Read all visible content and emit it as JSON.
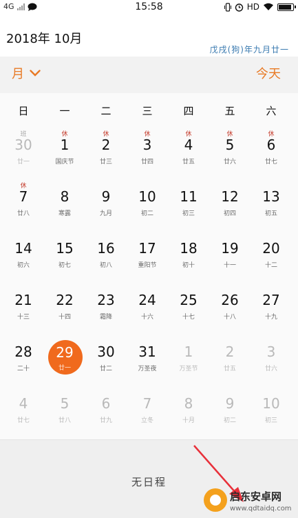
{
  "status_bar": {
    "network": "4G",
    "time": "15:58",
    "hd_label": "HD",
    "battery_level": 0.95,
    "icons": [
      "message-icon",
      "vibrate-icon",
      "alarm-icon",
      "wifi-icon",
      "battery-icon"
    ]
  },
  "header": {
    "year_month": "2018年 10月",
    "lunar_date": "戊戌(狗)年九月廿一"
  },
  "toolbar": {
    "view_label": "月",
    "today_label": "今天"
  },
  "colors": {
    "accent": "#e87a25",
    "selected": "#f06a1d",
    "holiday_tag": "#c43a2a",
    "lunar_text": "#3a7ab0"
  },
  "calendar": {
    "weekdays": [
      "日",
      "一",
      "二",
      "三",
      "四",
      "五",
      "六"
    ],
    "weeks": [
      [
        {
          "day": "30",
          "lunar": "廿一",
          "tag": "班",
          "other": true
        },
        {
          "day": "1",
          "lunar": "国庆节",
          "tag": "休"
        },
        {
          "day": "2",
          "lunar": "廿三",
          "tag": "休"
        },
        {
          "day": "3",
          "lunar": "廿四",
          "tag": "休"
        },
        {
          "day": "4",
          "lunar": "廿五",
          "tag": "休"
        },
        {
          "day": "5",
          "lunar": "廿六",
          "tag": "休"
        },
        {
          "day": "6",
          "lunar": "廿七",
          "tag": "休"
        }
      ],
      [
        {
          "day": "7",
          "lunar": "廿八",
          "tag": "休"
        },
        {
          "day": "8",
          "lunar": "寒露"
        },
        {
          "day": "9",
          "lunar": "九月"
        },
        {
          "day": "10",
          "lunar": "初二"
        },
        {
          "day": "11",
          "lunar": "初三"
        },
        {
          "day": "12",
          "lunar": "初四"
        },
        {
          "day": "13",
          "lunar": "初五"
        }
      ],
      [
        {
          "day": "14",
          "lunar": "初六"
        },
        {
          "day": "15",
          "lunar": "初七"
        },
        {
          "day": "16",
          "lunar": "初八"
        },
        {
          "day": "17",
          "lunar": "重阳节"
        },
        {
          "day": "18",
          "lunar": "初十"
        },
        {
          "day": "19",
          "lunar": "十一"
        },
        {
          "day": "20",
          "lunar": "十二"
        }
      ],
      [
        {
          "day": "21",
          "lunar": "十三"
        },
        {
          "day": "22",
          "lunar": "十四"
        },
        {
          "day": "23",
          "lunar": "霜降"
        },
        {
          "day": "24",
          "lunar": "十六"
        },
        {
          "day": "25",
          "lunar": "十七"
        },
        {
          "day": "26",
          "lunar": "十八"
        },
        {
          "day": "27",
          "lunar": "十九"
        }
      ],
      [
        {
          "day": "28",
          "lunar": "二十"
        },
        {
          "day": "29",
          "lunar": "廿一",
          "selected": true
        },
        {
          "day": "30",
          "lunar": "廿二"
        },
        {
          "day": "31",
          "lunar": "万圣夜"
        },
        {
          "day": "1",
          "lunar": "万圣节",
          "other": true
        },
        {
          "day": "2",
          "lunar": "廿五",
          "other": true
        },
        {
          "day": "3",
          "lunar": "廿六",
          "other": true
        }
      ],
      [
        {
          "day": "4",
          "lunar": "廿七",
          "other": true
        },
        {
          "day": "5",
          "lunar": "廿八",
          "other": true
        },
        {
          "day": "6",
          "lunar": "廿九",
          "other": true
        },
        {
          "day": "7",
          "lunar": "立冬",
          "other": true
        },
        {
          "day": "8",
          "lunar": "十月",
          "other": true
        },
        {
          "day": "9",
          "lunar": "初二",
          "other": true
        },
        {
          "day": "10",
          "lunar": "初三",
          "other": true
        }
      ]
    ]
  },
  "schedule": {
    "empty_label": "无日程"
  },
  "watermark": {
    "title": "启东安卓网",
    "url": "www.qdtaidq.com"
  }
}
